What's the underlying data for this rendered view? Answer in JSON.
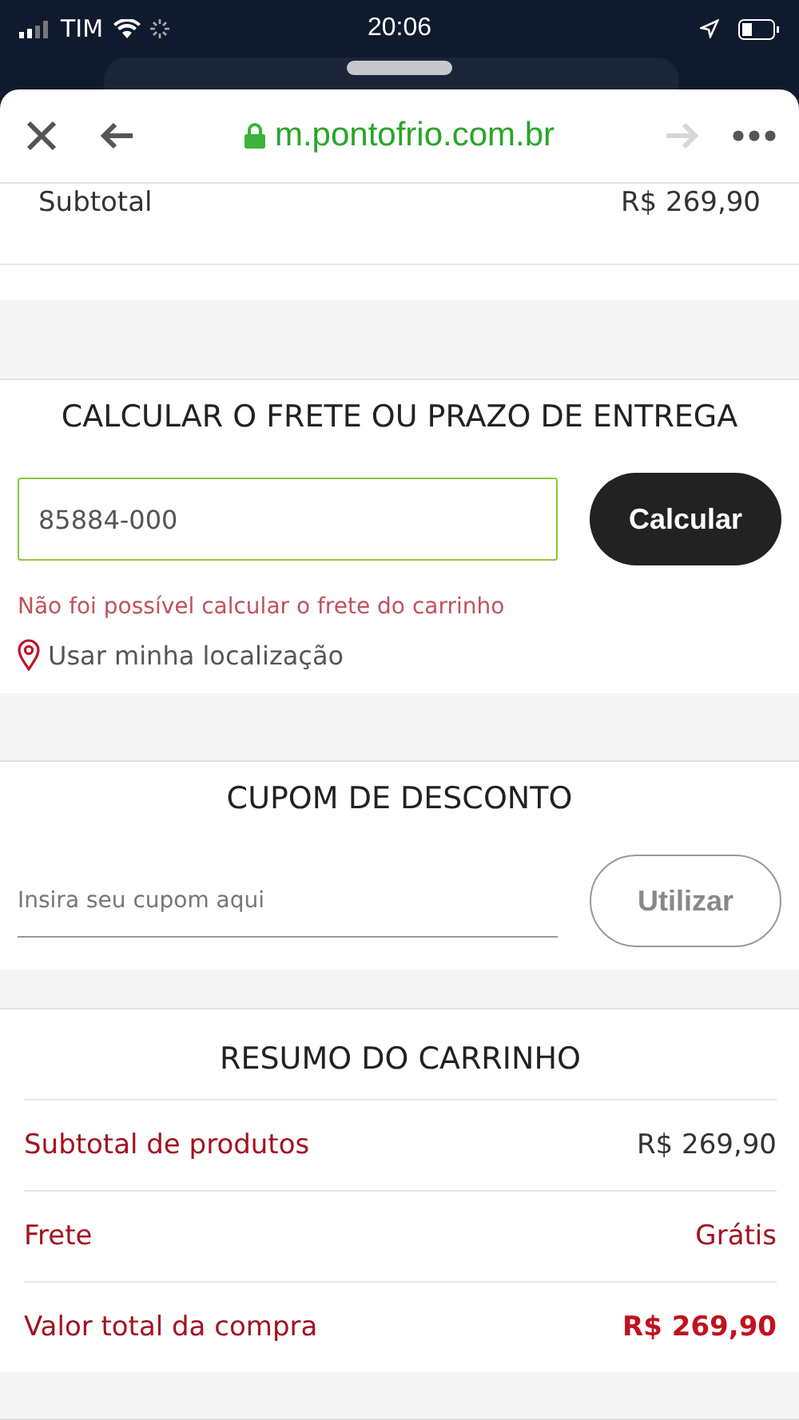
{
  "status_bar": {
    "carrier": "TIM",
    "time": "20:06"
  },
  "browser": {
    "url": "m.pontofrio.com.br",
    "forward_disabled": true
  },
  "subtotal": {
    "label": "Subtotal",
    "value": "R$ 269,90"
  },
  "shipping": {
    "title": "CALCULAR O FRETE OU PRAZO DE ENTREGA",
    "zip": "85884-000",
    "button": "Calcular",
    "error": "Não foi possível calcular o frete do carrinho",
    "location": "Usar minha localização"
  },
  "coupon": {
    "title": "CUPOM DE DESCONTO",
    "placeholder": "Insira seu cupom aqui",
    "button": "Utilizar"
  },
  "summary": {
    "title": "RESUMO DO CARRINHO",
    "rows": [
      {
        "kind": "amount",
        "label": "Subtotal de produtos",
        "value": "R$ 269,90"
      },
      {
        "kind": "free",
        "label": "Frete",
        "value": "Grátis"
      },
      {
        "kind": "total",
        "label": "Valor total da compra",
        "value": "R$ 269,90"
      }
    ]
  }
}
